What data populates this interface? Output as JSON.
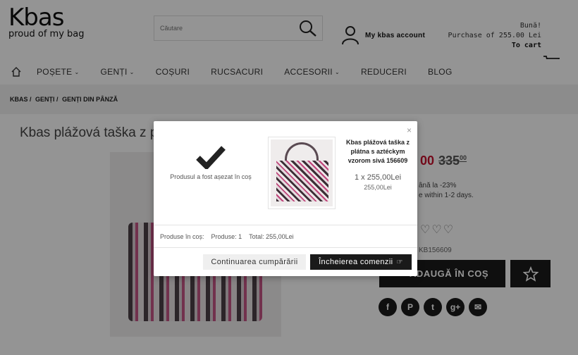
{
  "header": {
    "logo_main": "Kbas",
    "logo_tagline": "proud of my bag",
    "search_placeholder": "Căutare",
    "account_label": "My kbas account",
    "greeting": "Bună!",
    "purchase_text": "Purchase of 255.00 Lei",
    "to_cart": "To cart"
  },
  "nav": {
    "items": [
      {
        "label": "POȘETE",
        "has_dropdown": true
      },
      {
        "label": "GENȚI",
        "has_dropdown": true
      },
      {
        "label": "COȘURI",
        "has_dropdown": false
      },
      {
        "label": "RUCSACURI",
        "has_dropdown": false
      },
      {
        "label": "ACCESORII",
        "has_dropdown": true
      },
      {
        "label": "REDUCERI",
        "has_dropdown": false
      },
      {
        "label": "BLOG",
        "has_dropdown": false
      }
    ]
  },
  "breadcrumb": [
    "KBAS /",
    "GENȚI /",
    "GENȚI DIN PÂNZĂ"
  ],
  "product": {
    "title": "Kbas plážová taška z p",
    "price_new_partial": "00",
    "price_old": "335",
    "price_old_cents": "00",
    "discount_text": "ână la -23%",
    "delivery_text": "e within 1-2 days.",
    "sku_partial": "KB156609",
    "add_to_cart": "ADAUGĂ ÎN COȘ",
    "social": [
      "f",
      "P",
      "t",
      "g+",
      "✉"
    ]
  },
  "modal": {
    "added_message": "Produsul a fost așezat în coș",
    "product_name": "Kbas plážová taška z plátna s aztéckym vzorom sivá 156609",
    "qty_price": "1 x 255,00Lei",
    "unit_price": "255,00Lei",
    "summary_label": "Produse în coș:",
    "summary_count": "Produse: 1",
    "summary_total": "Total: 255,00Lei",
    "continue_label": "Continuarea cumpărării",
    "checkout_label": "Încheierea comenzii",
    "close_symbol": "×"
  },
  "colors": {
    "accent_price": "#c8102e",
    "dark_button": "#1a1a1a"
  }
}
